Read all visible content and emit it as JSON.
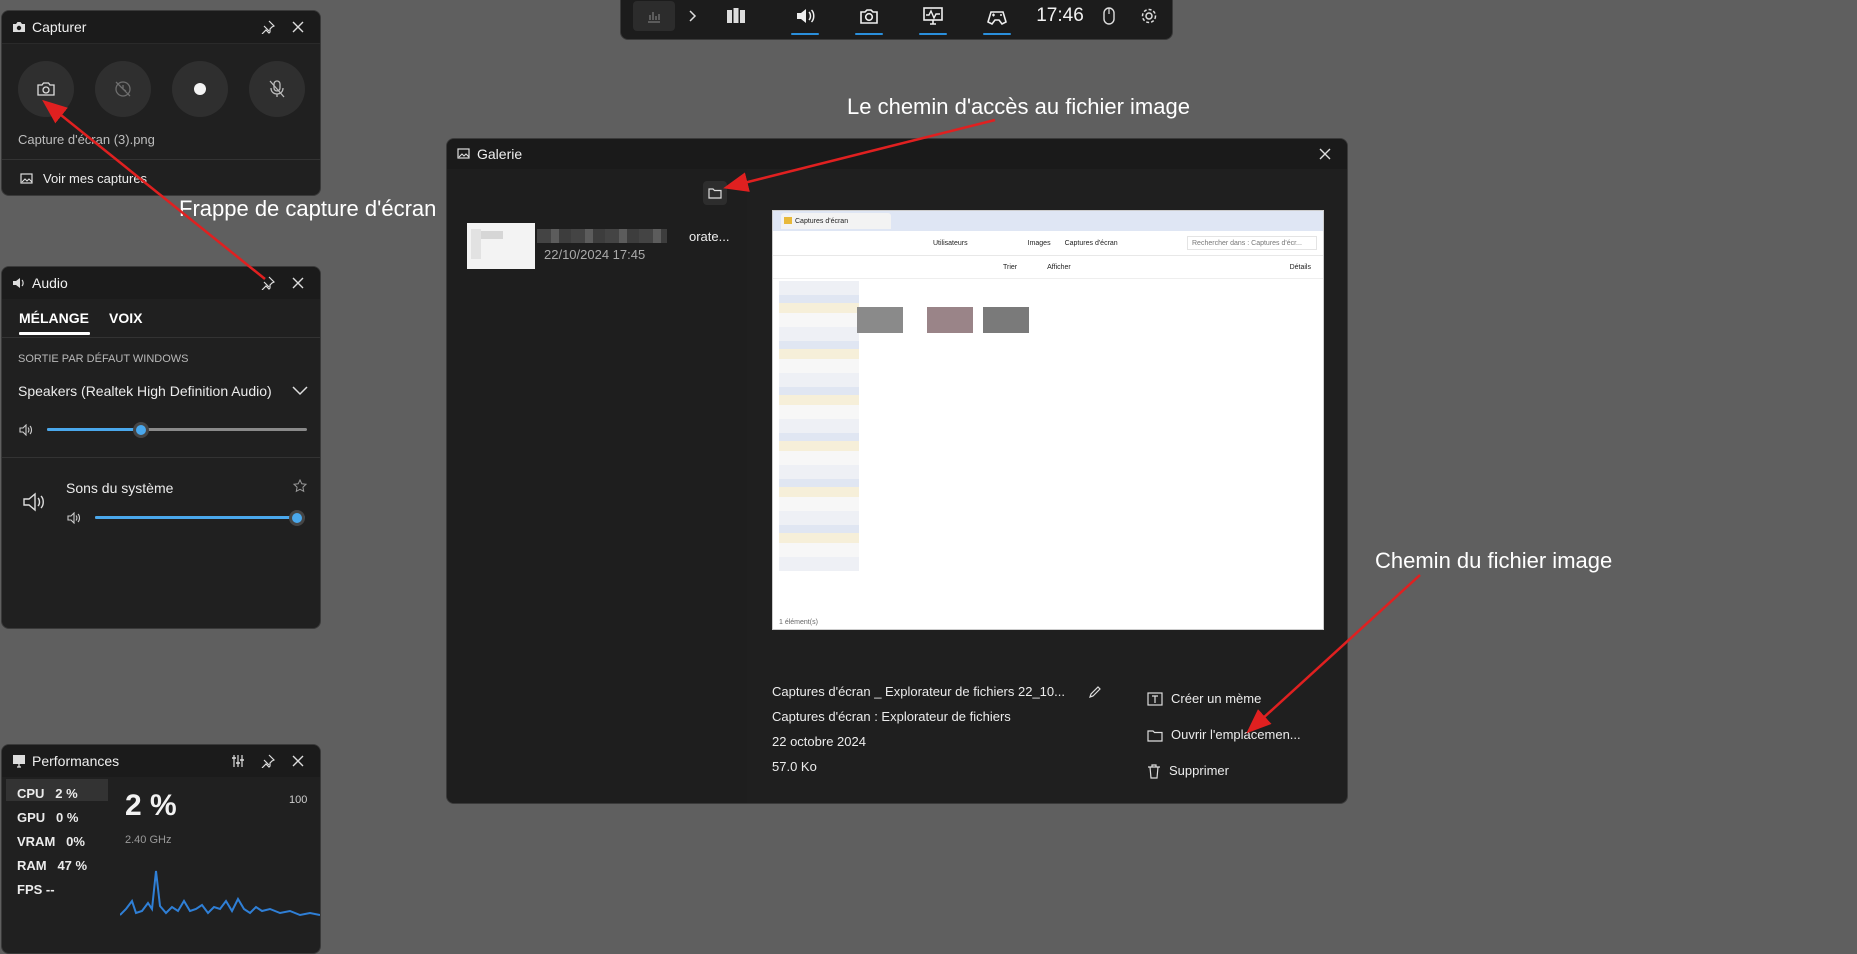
{
  "gamebar": {
    "time": "17:46",
    "icons": [
      "chart-icon",
      "chevron-right-icon",
      "widget-menu-icon",
      "volume-icon",
      "camera-icon",
      "performance-icon",
      "gamepad-icon",
      "mouse-icon",
      "gear-icon"
    ],
    "accent": "#2a8fdc"
  },
  "capture": {
    "title": "Capturer",
    "last_file": "Capture d'écran (3).png",
    "gallery_link": "Voir mes captures"
  },
  "audio": {
    "title": "Audio",
    "tabs": [
      "MÉLANGE",
      "VOIX"
    ],
    "section_label": "SORTIE PAR DÉFAUT WINDOWS",
    "device": "Speakers (Realtek High Definition Audio)",
    "master_level": 0.36,
    "system_label": "Sons du système",
    "system_level": 1.0
  },
  "performance": {
    "title": "Performances",
    "stats": [
      {
        "label": "CPU",
        "value": "2 %"
      },
      {
        "label": "GPU",
        "value": "0 %"
      },
      {
        "label": "VRAM",
        "value": "0%"
      },
      {
        "label": "RAM",
        "value": "47 %"
      },
      {
        "label": "FPS",
        "value": "--"
      }
    ],
    "big_value": "2 %",
    "frequency": "2.40 GHz",
    "max": "100",
    "graph_color": "#2f7fd6"
  },
  "gallery": {
    "title": "Galerie",
    "item_title": "orate...",
    "item_date": "22/10/2024 17:45",
    "preview": {
      "tab_title": "Captures d'écran",
      "path_parts": [
        "Utilisateurs",
        "Images",
        "Captures d'écran"
      ],
      "search_placeholder": "Rechercher dans : Captures d'écr...",
      "sort_label": "Trier",
      "view_label": "Afficher",
      "details_label": "Détails",
      "status": "1 élément(s)"
    },
    "info": {
      "filename": "Captures d'écran _ Explorateur de fichiers 22_10...",
      "source": "Captures d'écran : Explorateur de fichiers",
      "date": "22 octobre 2024",
      "size": "57.0 Ko"
    },
    "actions": {
      "meme": "Créer un mème",
      "open_location": "Ouvrir l'emplacemen...",
      "delete": "Supprimer"
    }
  },
  "annotations": {
    "path_top": "Le chemin d'accès au fichier image",
    "screenshot_key": "Frappe de capture d'écran",
    "path_right": "Chemin du fichier image",
    "arrow_color": "#e02020"
  }
}
